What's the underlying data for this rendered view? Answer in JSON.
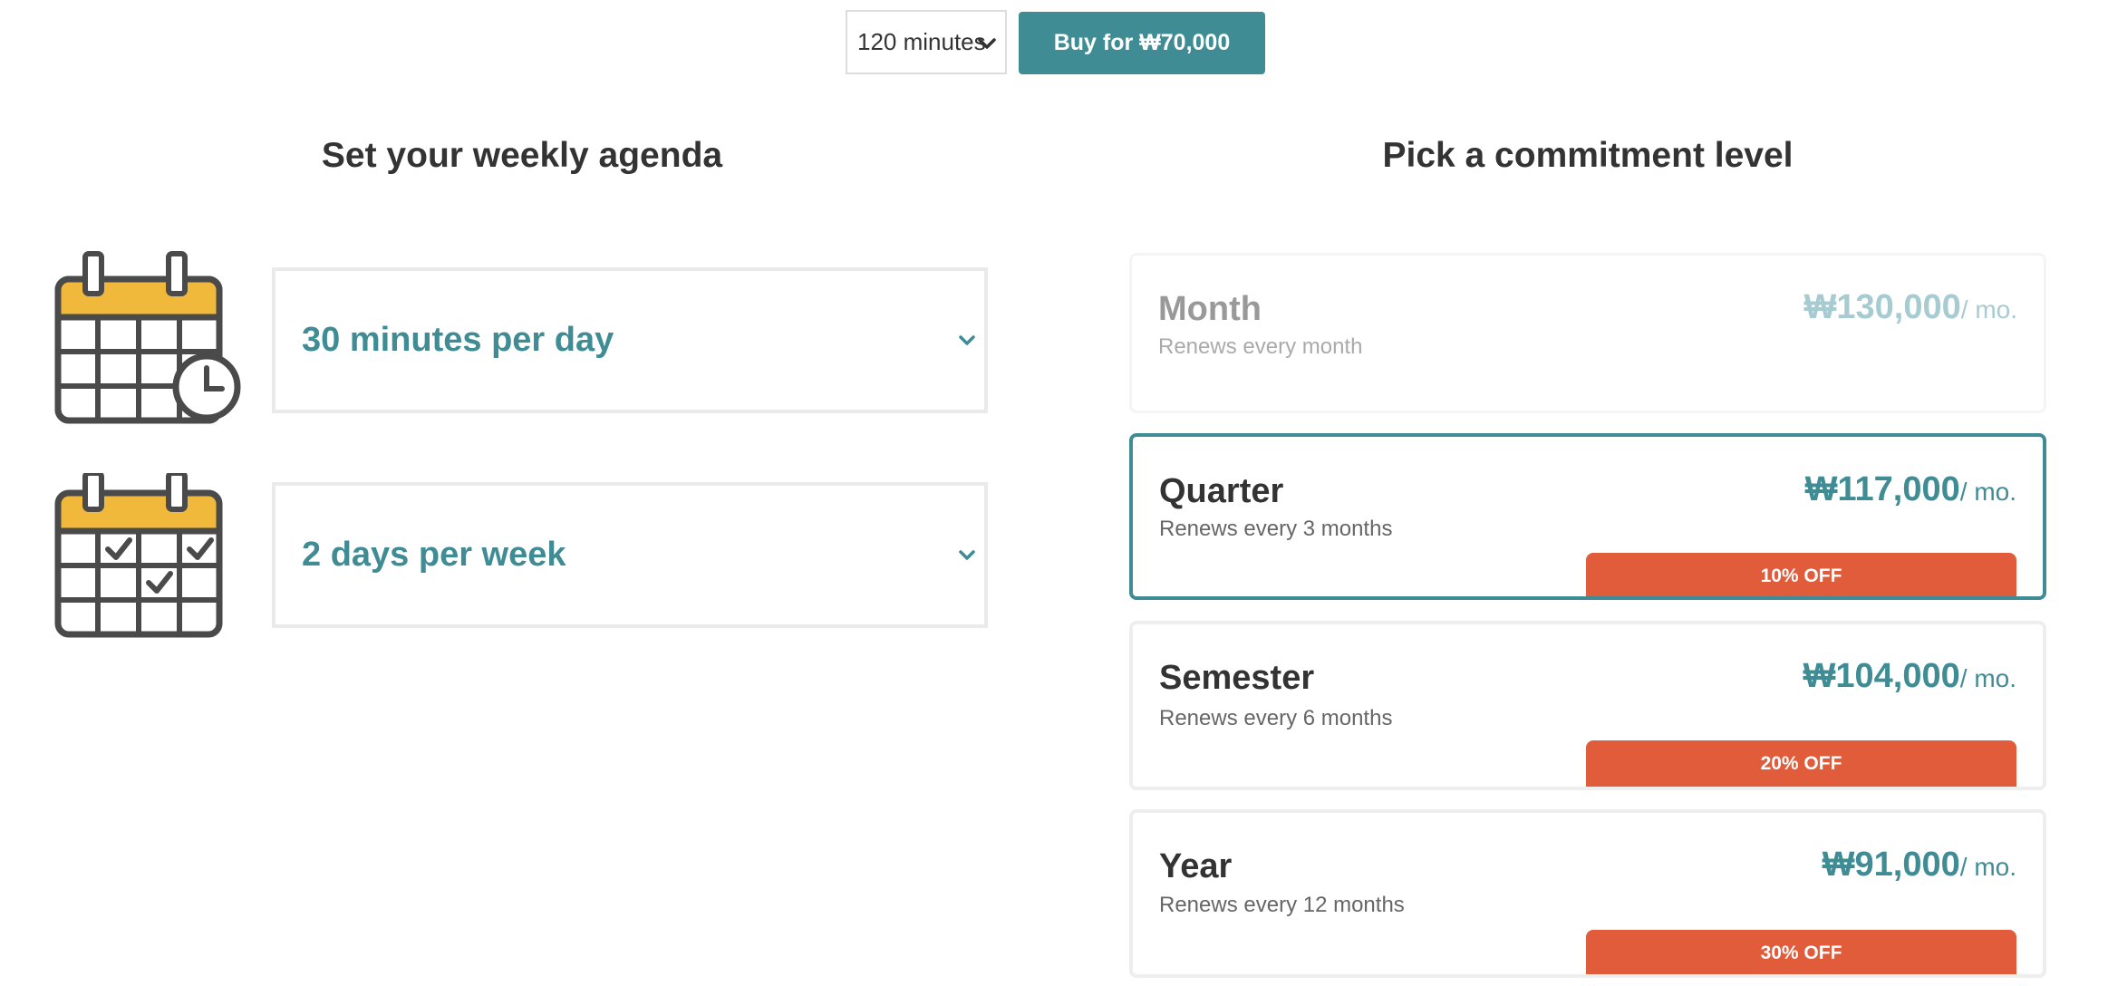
{
  "purchase": {
    "duration_value": "120 minutes",
    "buy_label": "Buy for ₩70,000",
    "colors": {
      "accent": "#3f8c95"
    }
  },
  "agenda": {
    "title": "Set your weekly agenda",
    "daily_minutes": {
      "value": "30 minutes per day",
      "icon": "calendar-clock-icon"
    },
    "weekly_days": {
      "value": "2 days per week",
      "icon": "calendar-check-icon"
    }
  },
  "commitment": {
    "title": "Pick a commitment level",
    "plans": [
      {
        "name": "Month",
        "renew": "Renews every month",
        "price": "₩130,000",
        "per": "/ mo.",
        "discount": "",
        "state": "dimmed"
      },
      {
        "name": "Quarter",
        "renew": "Renews every 3 months",
        "price": "₩117,000",
        "per": "/ mo.",
        "discount": "10% OFF",
        "state": "selected"
      },
      {
        "name": "Semester",
        "renew": "Renews every 6 months",
        "price": "₩104,000",
        "per": "/ mo.",
        "discount": "20% OFF",
        "state": "normal"
      },
      {
        "name": "Year",
        "renew": "Renews every 12 months",
        "price": "₩91,000",
        "per": "/ mo.",
        "discount": "30% OFF",
        "state": "normal"
      }
    ],
    "colors": {
      "discount": "#e05c3b",
      "calendar_header": "#f0b93b"
    }
  }
}
